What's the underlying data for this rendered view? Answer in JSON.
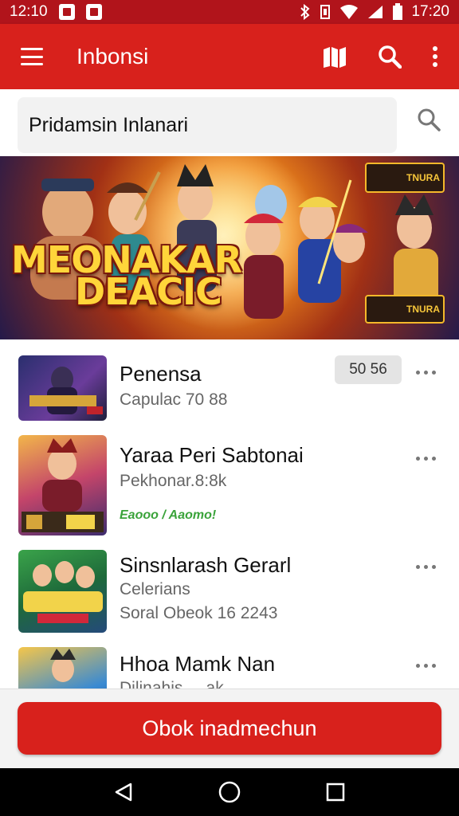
{
  "status_bar": {
    "time_left": "12:10",
    "time_right": "17:20"
  },
  "app_bar": {
    "title": "Inbonsi",
    "icons": [
      "menu-icon",
      "map-icon",
      "search-icon",
      "more-vert-icon"
    ]
  },
  "search": {
    "value": "Pridamsin Inlanari"
  },
  "banner": {
    "title_line1": "MEONAKAR",
    "title_line2": "DEACIC",
    "badge_top": "TNURA",
    "badge_bottom": "TNURA"
  },
  "list": [
    {
      "title": "Penensa",
      "subtitle": "Capulac 70 88",
      "pill": "50 56"
    },
    {
      "title": "Yaraa Peri Sabtonai",
      "subtitle": "Pekhonar.8:8k",
      "tag": "Eaooo / Aaomo!"
    },
    {
      "title": "Sinsnlarash Gerarl",
      "subtitle": "Celerians",
      "subtitle2": "Soral Obeok 16 2243"
    },
    {
      "title": "Hhoa Mamk Nan",
      "subtitle": "Dilinahis ... ak"
    }
  ],
  "cta": {
    "label": "Obok inadmechun"
  },
  "colors": {
    "primary": "#d8211c",
    "status": "#b1141b"
  }
}
